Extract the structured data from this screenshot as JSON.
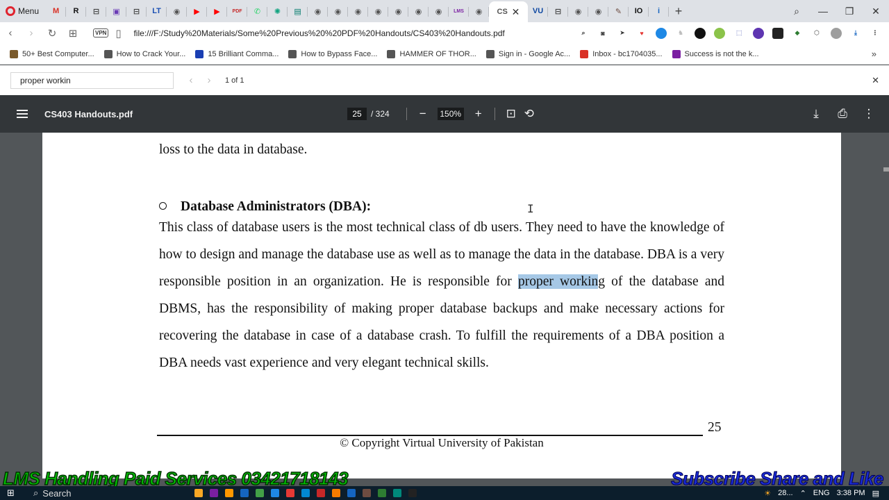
{
  "browser": {
    "menu_label": "Menu",
    "tabs": [
      {
        "icon": "gmail-icon",
        "label": "M",
        "color": "#d93025"
      },
      {
        "icon": "r-icon",
        "label": "R",
        "color": "#111111"
      },
      {
        "icon": "page-icon",
        "label": "⊟",
        "color": "#444444"
      },
      {
        "icon": "app-icon",
        "label": "▣",
        "color": "#6a3bb5"
      },
      {
        "icon": "page-icon",
        "label": "⊟",
        "color": "#444444"
      },
      {
        "icon": "lt-icon",
        "label": "LT",
        "color": "#1a4fb3"
      },
      {
        "icon": "globe-icon",
        "label": "◉",
        "color": "#555555"
      },
      {
        "icon": "youtube-icon",
        "label": "▶",
        "color": "#ff0000"
      },
      {
        "icon": "youtube-icon",
        "label": "▶",
        "color": "#ff0000"
      },
      {
        "icon": "pdf-icon",
        "label": "PDF",
        "color": "#c62828"
      },
      {
        "icon": "whatsapp-icon",
        "label": "✆",
        "color": "#25d366"
      },
      {
        "icon": "chatgpt-icon",
        "label": "✺",
        "color": "#10a37f"
      },
      {
        "icon": "chart-icon",
        "label": "▤",
        "color": "#00796b"
      },
      {
        "icon": "globe-icon",
        "label": "◉",
        "color": "#555555"
      },
      {
        "icon": "globe-icon",
        "label": "◉",
        "color": "#555555"
      },
      {
        "icon": "globe-icon",
        "label": "◉",
        "color": "#555555"
      },
      {
        "icon": "globe-icon",
        "label": "◉",
        "color": "#555555"
      },
      {
        "icon": "globe-icon",
        "label": "◉",
        "color": "#555555"
      },
      {
        "icon": "globe-icon",
        "label": "◉",
        "color": "#555555"
      },
      {
        "icon": "globe-icon",
        "label": "◉",
        "color": "#555555"
      },
      {
        "icon": "lms-icon",
        "label": "LMS",
        "color": "#7b1fa2"
      },
      {
        "icon": "globe-icon",
        "label": "◉",
        "color": "#555555"
      }
    ],
    "active_tab": {
      "icon": "globe-icon",
      "label": "CS"
    },
    "tabs_after": [
      {
        "icon": "vu-icon",
        "label": "VU",
        "color": "#0d47a1"
      },
      {
        "icon": "page-icon",
        "label": "⊟",
        "color": "#444444"
      },
      {
        "icon": "globe-icon",
        "label": "◉",
        "color": "#555555"
      },
      {
        "icon": "globe-icon",
        "label": "◉",
        "color": "#555555"
      },
      {
        "icon": "tool-icon",
        "label": "✎",
        "color": "#6d4c41"
      },
      {
        "icon": "io-icon",
        "label": "IO",
        "color": "#111111"
      },
      {
        "icon": "info-icon",
        "label": "i",
        "color": "#1565c0"
      }
    ],
    "new_tab_label": "+",
    "url": "file:///F:/Study%20Materials/Some%20Previous%20%20PDF%20Handouts/CS403%20Handouts.pdf",
    "vpn_label": "VPN"
  },
  "bookmarks": [
    {
      "label": "50+ Best Computer...",
      "color": "#7a5a2b"
    },
    {
      "label": "How to Crack Your...",
      "color": "#555555"
    },
    {
      "label": "15 Brilliant Comma...",
      "color": "#1a3fb3"
    },
    {
      "label": "How to Bypass Face...",
      "color": "#555555"
    },
    {
      "label": "HAMMER OF THOR...",
      "color": "#555555"
    },
    {
      "label": "Sign in - Google Ac...",
      "color": "#555555"
    },
    {
      "label": "Inbox - bc1704035...",
      "color": "#d93025"
    },
    {
      "label": "Success is not the k...",
      "color": "#7b1fa2"
    }
  ],
  "find": {
    "query": "proper workin",
    "count": "1 of 1"
  },
  "pdf": {
    "title": "CS403 Handouts.pdf",
    "page_current": "25",
    "page_total": "/ 324",
    "zoom": "150%",
    "lines": {
      "top": "loss to the data in database.",
      "heading": "Database Administrators (DBA):",
      "para_part1": "This class of database users is the most technical class of db users. They need to have the knowledge of how to design and manage the database use as well as to manage the data in the database. DBA is a very responsible position in an organization. He is responsible for ",
      "para_highlight": "proper workin",
      "para_part2": "g of the database and DBMS, has the responsibility of making proper database backups and make necessary actions for recovering the database in case of a database crash. To fulfill the requirements of a DBA position a DBA needs vast experience and very elegant technical skills."
    },
    "page_number": "25",
    "copyright": "© Copyright Virtual University of Pakistan"
  },
  "overlay": {
    "left_text": "LMS Handling Paid Services 03421718143",
    "right_text": "Subscribe Share and Like"
  },
  "taskbar": {
    "search_label": "Search",
    "temp": "28...",
    "lang": "ENG",
    "time": "3:38 PM"
  },
  "colors": {
    "highlight": "#a6c8e6",
    "pdf_toolbar": "#323639",
    "viewer_bg": "#525659"
  }
}
